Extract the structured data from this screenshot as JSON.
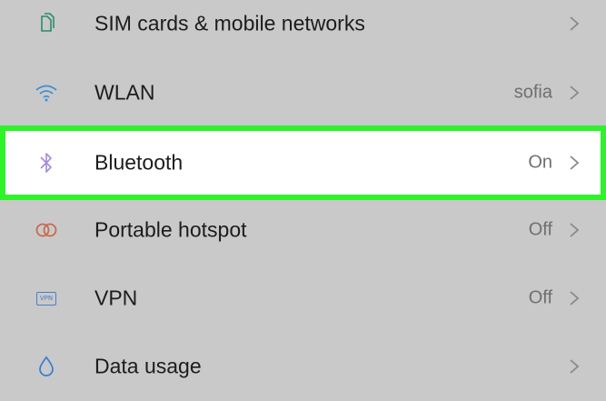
{
  "settings": {
    "items": [
      {
        "label": "SIM cards & mobile networks",
        "value": "",
        "icon": "sim-card-icon",
        "icon_color": "#2e8b6b"
      },
      {
        "label": "WLAN",
        "value": "sofia",
        "icon": "wifi-icon",
        "icon_color": "#3f8fd6"
      },
      {
        "label": "Bluetooth",
        "value": "On",
        "icon": "bluetooth-icon",
        "icon_color": "#a58bd6"
      },
      {
        "label": "Portable hotspot",
        "value": "Off",
        "icon": "hotspot-icon",
        "icon_color": "#c96a4e"
      },
      {
        "label": "VPN",
        "value": "Off",
        "icon": "vpn-icon",
        "icon_color": "#4a7fc8"
      },
      {
        "label": "Data usage",
        "value": "",
        "icon": "data-usage-icon",
        "icon_color": "#3a7fd0"
      }
    ],
    "vpn_badge_text": "VPN"
  },
  "colors": {
    "background": "#c9c9c9",
    "highlight_background": "#ffffff",
    "highlight_border": "#2ef22a",
    "label_text": "#1c1c1c",
    "value_text": "#6f6f6f",
    "chevron": "#8a8a8a"
  }
}
